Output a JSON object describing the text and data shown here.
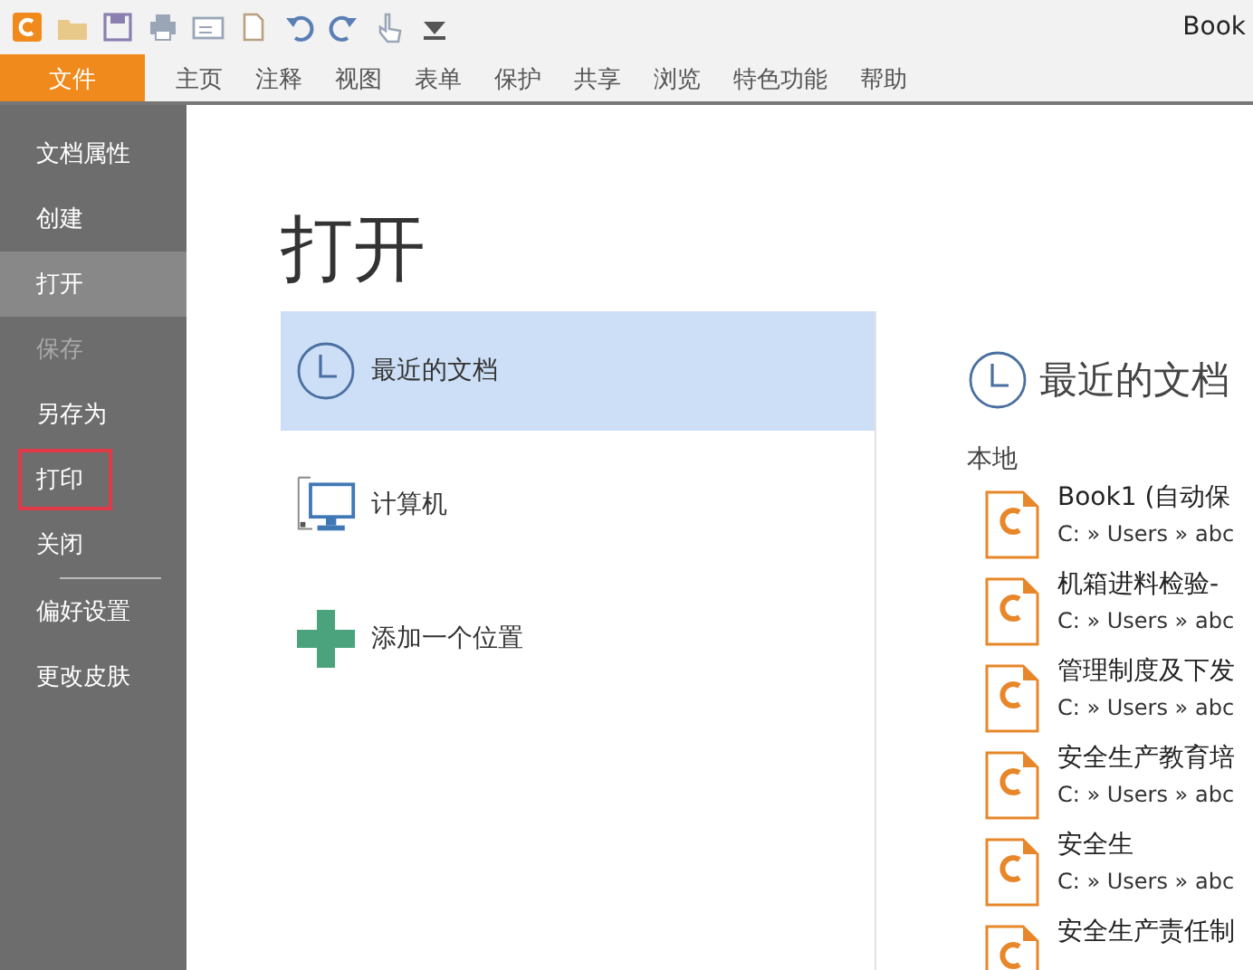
{
  "window": {
    "title": "Book"
  },
  "quick_toolbar": [
    {
      "kind": "logo"
    },
    {
      "kind": "open"
    },
    {
      "kind": "save"
    },
    {
      "kind": "print"
    },
    {
      "kind": "mail"
    },
    {
      "kind": "new"
    },
    {
      "kind": "undo"
    },
    {
      "kind": "redo"
    },
    {
      "kind": "hand"
    },
    {
      "kind": "customize"
    }
  ],
  "ribbon_tabs": [
    {
      "label": "文件",
      "selected": true
    },
    {
      "label": "主页",
      "selected": false
    },
    {
      "label": "注释",
      "selected": false
    },
    {
      "label": "视图",
      "selected": false
    },
    {
      "label": "表单",
      "selected": false
    },
    {
      "label": "保护",
      "selected": false
    },
    {
      "label": "共享",
      "selected": false
    },
    {
      "label": "浏览",
      "selected": false
    },
    {
      "label": "特色功能",
      "selected": false
    },
    {
      "label": "帮助",
      "selected": false
    }
  ],
  "sidebar": {
    "items": [
      {
        "label": "文档属性",
        "selected": false,
        "disabled": false,
        "highlighted": false,
        "divider_after": false
      },
      {
        "label": "创建",
        "selected": false,
        "disabled": false,
        "highlighted": false,
        "divider_after": false
      },
      {
        "label": "打开",
        "selected": true,
        "disabled": false,
        "highlighted": false,
        "divider_after": false
      },
      {
        "label": "保存",
        "selected": false,
        "disabled": true,
        "highlighted": false,
        "divider_after": false
      },
      {
        "label": "另存为",
        "selected": false,
        "disabled": false,
        "highlighted": false,
        "divider_after": false
      },
      {
        "label": "打印",
        "selected": false,
        "disabled": false,
        "highlighted": true,
        "divider_after": false
      },
      {
        "label": "关闭",
        "selected": false,
        "disabled": false,
        "highlighted": false,
        "divider_after": true
      },
      {
        "label": "偏好设置",
        "selected": false,
        "disabled": false,
        "highlighted": false,
        "divider_after": false
      },
      {
        "label": "更改皮肤",
        "selected": false,
        "disabled": false,
        "highlighted": false,
        "divider_after": false
      }
    ]
  },
  "page_title": "打开",
  "places": [
    {
      "kind": "recent",
      "label": "最近的文档",
      "selected": true
    },
    {
      "kind": "computer",
      "label": "计算机",
      "selected": false
    },
    {
      "kind": "add",
      "label": "添加一个位置",
      "selected": false
    }
  ],
  "recent": {
    "title": "最近的文档",
    "section": "本地",
    "files": [
      {
        "name": "Book1 (自动保",
        "path": "C: » Users » abc"
      },
      {
        "name": "机箱进料检验-",
        "path": "C: » Users » abc"
      },
      {
        "name": "管理制度及下发",
        "path": "C: » Users » abc"
      },
      {
        "name": "安全生产教育培",
        "path": "C: » Users » abc"
      },
      {
        "name": "安全生",
        "path": "C: » Users » abc"
      },
      {
        "name": "安全生产责任制"
      }
    ]
  }
}
